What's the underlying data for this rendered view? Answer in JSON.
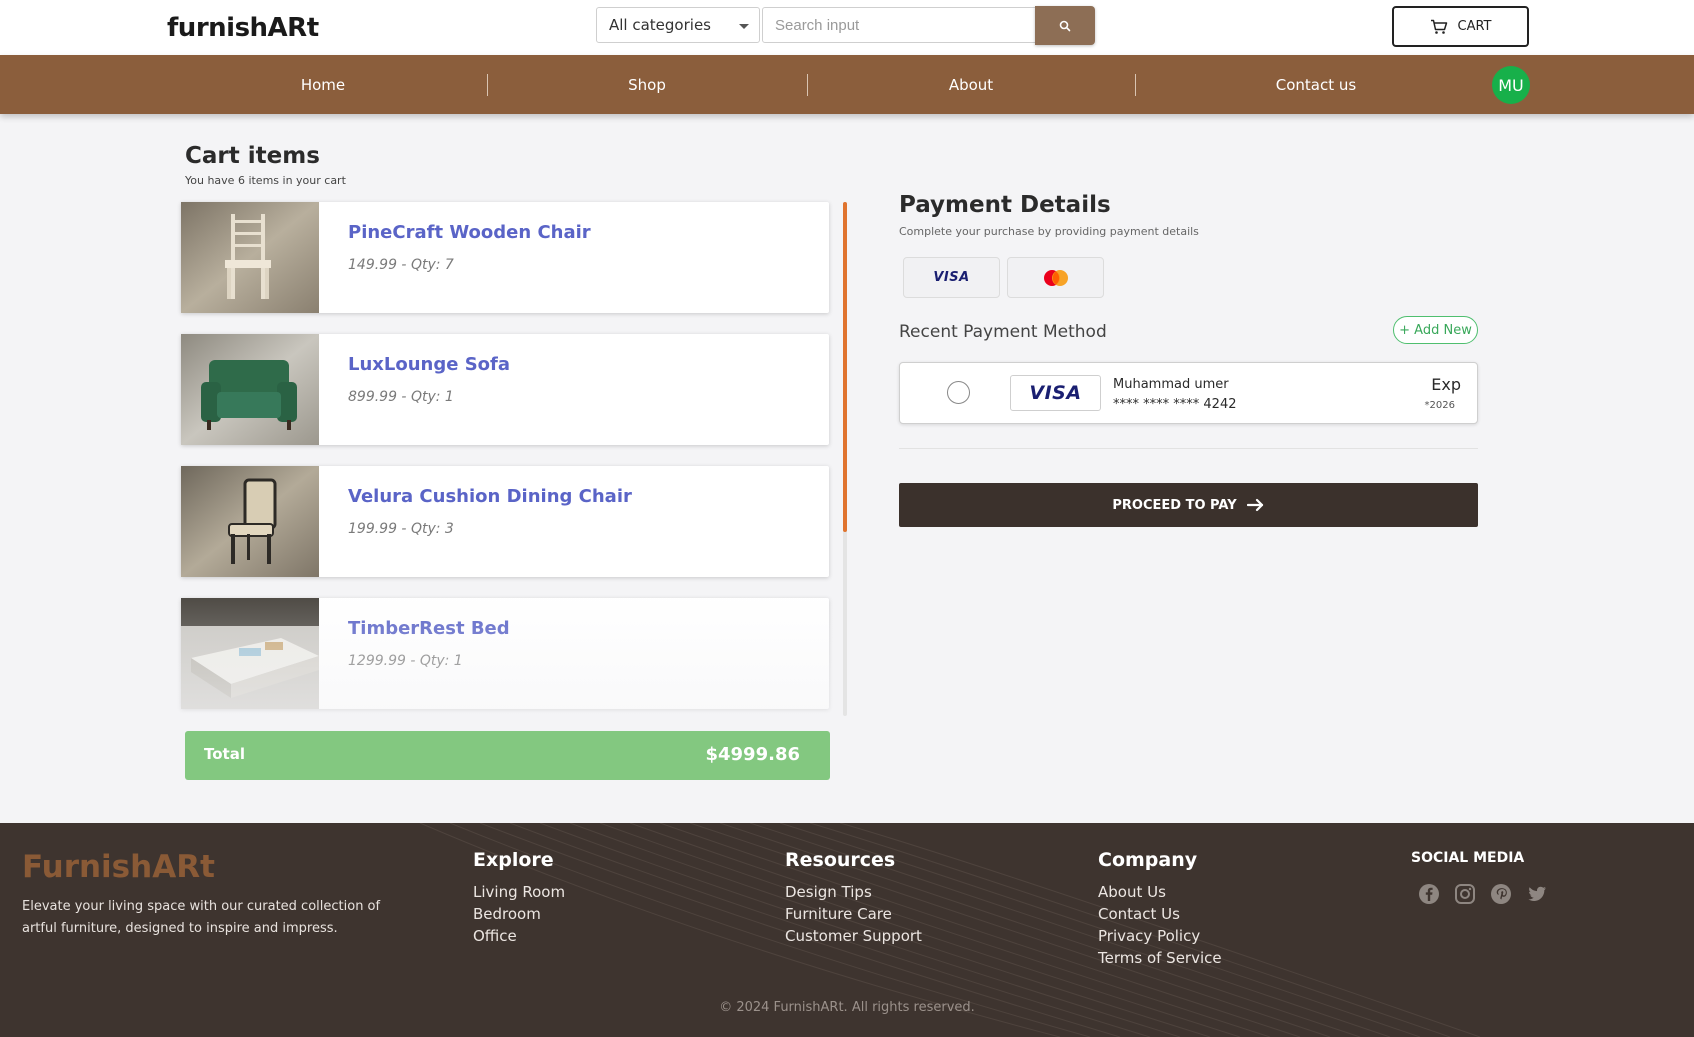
{
  "header": {
    "logo_text": "furnishARt",
    "category": "All categories",
    "search_placeholder": "Search input",
    "cart_label": "CART"
  },
  "nav": {
    "items": [
      "Home",
      "Shop",
      "About",
      "Contact us"
    ],
    "avatar_initials": "MU",
    "avatar_color": "#17b04a"
  },
  "cart": {
    "title": "Cart items",
    "subtitle": "You have 6 items in your cart",
    "items": [
      {
        "name": "PineCraft Wooden Chair",
        "meta": "149.99 - Qty: 7"
      },
      {
        "name": "LuxLounge Sofa",
        "meta": "899.99 - Qty: 1"
      },
      {
        "name": "Velura Cushion Dining Chair",
        "meta": "199.99 - Qty: 3"
      },
      {
        "name": "TimberRest Bed",
        "meta": "1299.99 - Qty: 1"
      }
    ],
    "total_label": "Total",
    "total_value": "$4999.86"
  },
  "payment": {
    "title": "Payment Details",
    "subtitle": "Complete your purchase by providing payment details",
    "card_options": [
      "visa-logo",
      "mastercard-logo"
    ],
    "visa_text": "VISA",
    "recent_label": "Recent Payment Method",
    "add_new_label": "+ Add New",
    "method": {
      "holder": "Muhammad umer",
      "masked_number": "**** **** **** 4242",
      "exp_label": "Exp",
      "exp_year": "*2026"
    },
    "proceed_label": "PROCEED TO PAY"
  },
  "footer": {
    "brand": "FurnishARt",
    "description": "Elevate your living space with our curated collection of artful furniture, designed to inspire and impress.",
    "columns": [
      {
        "title": "Explore",
        "links": [
          "Living Room",
          "Bedroom",
          "Office"
        ]
      },
      {
        "title": "Resources",
        "links": [
          "Design Tips",
          "Furniture Care",
          "Customer Support"
        ]
      },
      {
        "title": "Company",
        "links": [
          "About Us",
          "Contact Us",
          "Privacy Policy",
          "Terms of Service"
        ]
      }
    ],
    "social_title": "SOCIAL MEDIA",
    "social_icons": [
      "facebook-icon",
      "instagram-icon",
      "pinterest-icon",
      "twitter-icon"
    ],
    "copyright": "© 2024 FurnishARt. All rights reserved."
  },
  "colors": {
    "brand_brown": "#8b5e3c",
    "accent_orange": "#e0742f",
    "total_green": "#83c880",
    "pay_button": "#3b312c",
    "product_name": "#5a64c7"
  }
}
